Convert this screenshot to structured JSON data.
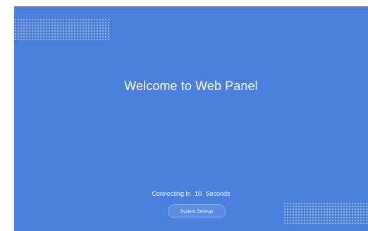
{
  "welcome": {
    "title": "Welcome to Web Panel"
  },
  "status": {
    "prefix": "Connecting in",
    "seconds": "10",
    "suffix": "Seconds"
  },
  "actions": {
    "system_settings_label": "System Settings"
  },
  "colors": {
    "background": "#4a7fde",
    "text": "#ffffff"
  }
}
